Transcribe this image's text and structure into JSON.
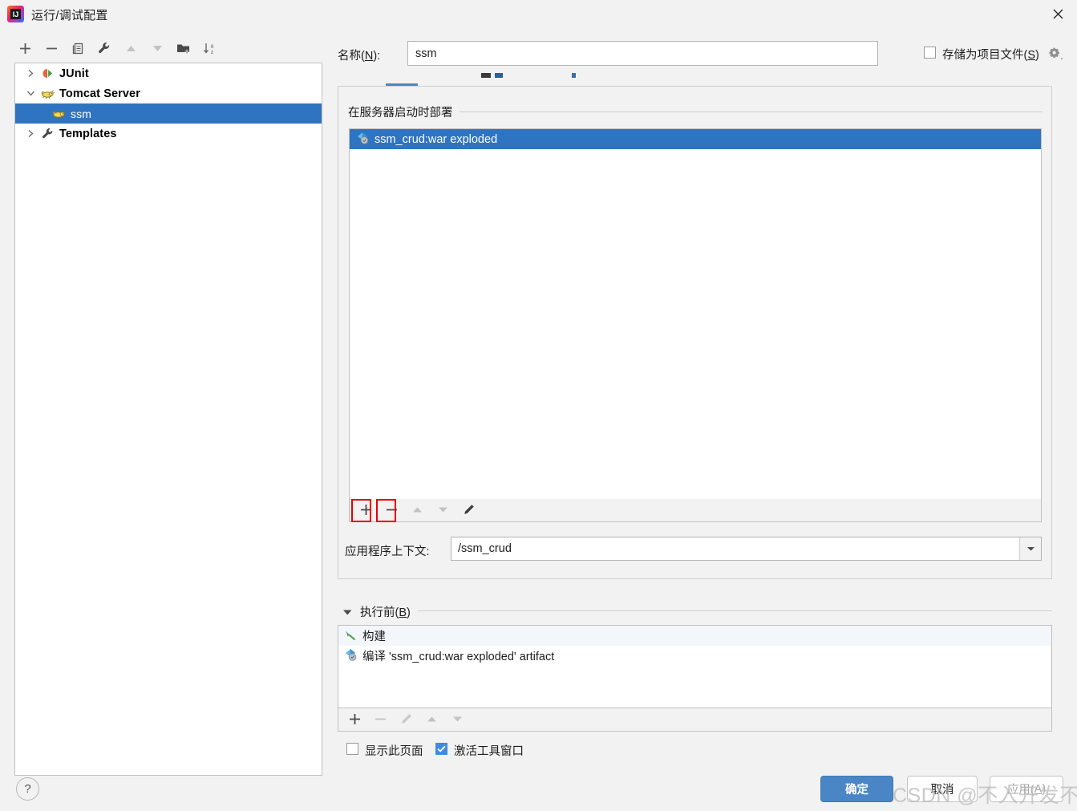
{
  "window": {
    "title": "运行/调试配置",
    "logo_icon": "intellij-idea-logo",
    "close_icon": "close-icon"
  },
  "left_toolbar": {
    "buttons": [
      {
        "name": "add",
        "icon": "plus-icon",
        "enabled": true
      },
      {
        "name": "remove",
        "icon": "minus-icon",
        "enabled": true
      },
      {
        "name": "copy",
        "icon": "copy-icon",
        "enabled": true
      },
      {
        "name": "edit-templates",
        "icon": "wrench-icon",
        "enabled": true
      },
      {
        "name": "move-up",
        "icon": "arrow-up-icon",
        "enabled": false
      },
      {
        "name": "move-down",
        "icon": "arrow-down-icon",
        "enabled": false
      },
      {
        "name": "new-folder",
        "icon": "folder-add-icon",
        "enabled": true
      },
      {
        "name": "sort-alphabetically",
        "icon": "sort-az-icon",
        "enabled": true
      }
    ]
  },
  "tree": {
    "items": [
      {
        "label": "JUnit",
        "icon": "junit-icon",
        "level": 1,
        "expanded": false,
        "selected": false,
        "has_twisty": true,
        "bold": true
      },
      {
        "label": "Tomcat Server",
        "icon": "tomcat-icon",
        "level": 1,
        "expanded": true,
        "selected": false,
        "has_twisty": true,
        "bold": true
      },
      {
        "label": "ssm",
        "icon": "tomcat-icon",
        "level": 2,
        "expanded": false,
        "selected": true,
        "has_twisty": false,
        "bold": false
      },
      {
        "label": "Templates",
        "icon": "wrench-icon",
        "level": 1,
        "expanded": false,
        "selected": false,
        "has_twisty": true,
        "bold": true
      }
    ]
  },
  "name_row": {
    "label_prefix": "名称(",
    "label_mnemonic": "N",
    "label_suffix": "):",
    "value": "ssm",
    "placeholder": "",
    "store_as_project_file": {
      "prefix": "存储为项目文件(",
      "mnemonic": "S",
      "suffix": ")",
      "checked": false
    },
    "gear_icon": "gear-icon"
  },
  "deployment": {
    "group_title": "在服务器启动时部署",
    "rows": [
      {
        "label": "ssm_crud:war exploded",
        "icon": "artifact-icon",
        "selected": true
      }
    ],
    "toolbar": [
      {
        "name": "add-artifact",
        "icon": "plus-icon",
        "enabled": true,
        "highlighted": true
      },
      {
        "name": "remove-artifact",
        "icon": "minus-icon",
        "enabled": true,
        "highlighted": true
      },
      {
        "name": "move-up-artifact",
        "icon": "arrow-up-icon",
        "enabled": false,
        "highlighted": false
      },
      {
        "name": "move-down-artifact",
        "icon": "arrow-down-icon",
        "enabled": false,
        "highlighted": false
      },
      {
        "name": "edit-artifact",
        "icon": "pencil-icon",
        "enabled": true,
        "highlighted": false
      }
    ],
    "context": {
      "label": "应用程序上下文:",
      "value": "/ssm_crud",
      "dropdown_icon": "chevron-down-icon"
    }
  },
  "before_launch": {
    "expander_icon": "triangle-down-icon",
    "title_prefix": "执行前(",
    "title_mnemonic": "B",
    "title_suffix": ")",
    "rows": [
      {
        "label": "构建",
        "icon": "build-hammer-icon"
      },
      {
        "label": "编译 'ssm_crud:war exploded' artifact",
        "icon": "artifact-icon"
      }
    ],
    "toolbar": [
      {
        "name": "add-task",
        "icon": "plus-icon",
        "enabled": true
      },
      {
        "name": "remove-task",
        "icon": "minus-icon",
        "enabled": false
      },
      {
        "name": "edit-task",
        "icon": "pencil-icon",
        "enabled": false
      },
      {
        "name": "move-up-task",
        "icon": "arrow-up-icon",
        "enabled": false
      },
      {
        "name": "move-down-task",
        "icon": "arrow-down-icon",
        "enabled": false
      }
    ],
    "checkboxes": [
      {
        "label": "显示此页面",
        "checked": false
      },
      {
        "label": "激活工具窗口",
        "checked": true
      }
    ]
  },
  "footer": {
    "help_icon": "question-mark-icon",
    "ok_label": "确定",
    "cancel_label": "取消",
    "apply_prefix": "应用(",
    "apply_mnemonic": "A",
    "apply_suffix": ")",
    "apply_enabled": false
  },
  "watermark": {
    "text": "CSDN @不入开发不工作"
  },
  "colors": {
    "selection_blue": "#2f74c0",
    "primary_button": "#4a86c5",
    "checkbox_on": "#3d8ce0",
    "highlight_red": "#e60000",
    "panel_bg": "#f2f2f2",
    "field_bg": "#ffffff"
  }
}
